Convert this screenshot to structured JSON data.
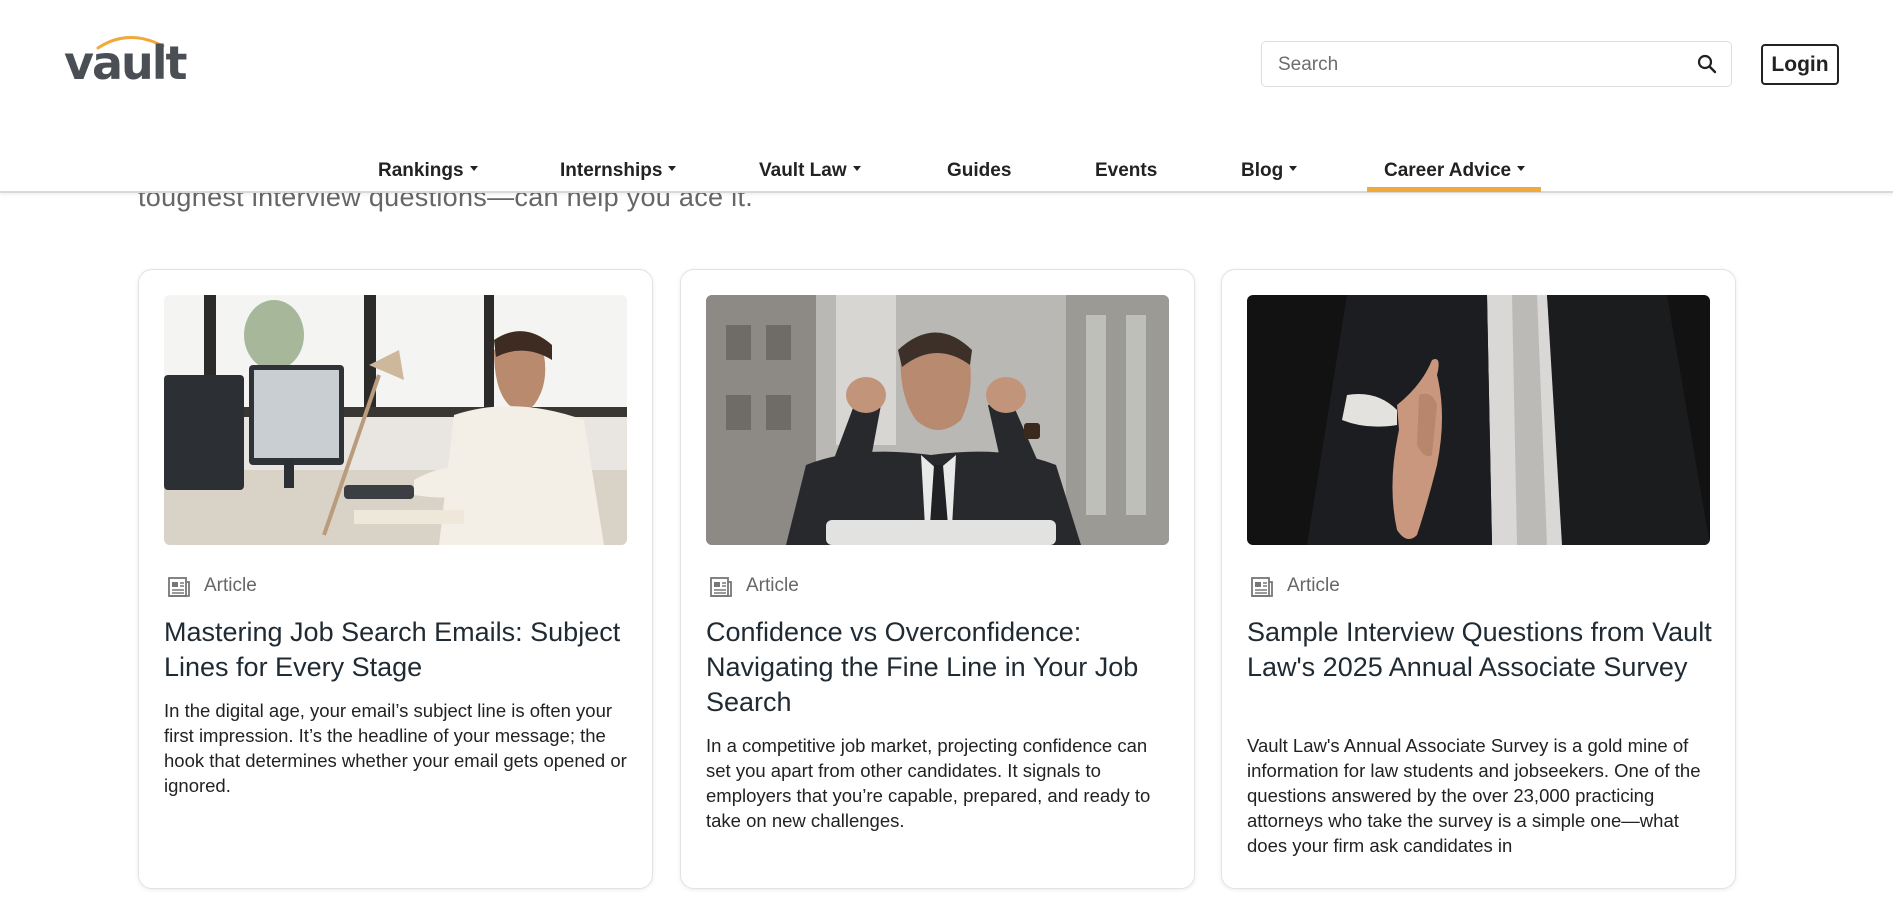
{
  "header": {
    "logo_text": "vault",
    "search": {
      "placeholder": "Search",
      "value": ""
    },
    "login_label": "Login"
  },
  "nav": {
    "items": [
      {
        "label": "Rankings",
        "dropdown": true
      },
      {
        "label": "Internships",
        "dropdown": true
      },
      {
        "label": "Vault Law",
        "dropdown": true
      },
      {
        "label": "Guides",
        "dropdown": false
      },
      {
        "label": "Events",
        "dropdown": false
      },
      {
        "label": "Blog",
        "dropdown": true
      },
      {
        "label": "Career Advice",
        "dropdown": true,
        "active": true
      }
    ],
    "active_color": "#f2a93b"
  },
  "intro_text": "toughest interview questions—can help you ace it.",
  "cards": [
    {
      "type": "Article",
      "image": "man-smiling-at-computer-desk",
      "title": "Mastering Job Search Emails: Subject Lines for Every Stage",
      "description": "In the digital age, your email’s subject line is often your first impression. It’s the headline of your message; the hook that determines whether your email gets opened or ignored."
    },
    {
      "type": "Article",
      "image": "man-celebrating-fists-raised",
      "title": "Confidence vs Overconfidence: Navigating the Fine Line in Your Job Search",
      "description": "In a competitive job market, projecting confidence can set you apart from other candidates. It signals to employers that you’re capable, prepared, and ready to take on new challenges."
    },
    {
      "type": "Article",
      "image": "businessman-extending-handshake",
      "title": "Sample Interview Questions from Vault Law's 2025 Annual Associate Survey",
      "description": "Vault Law's Annual Associate Survey is a gold mine of information for law students and jobseekers. One of the questions answered by the over 23,000 practicing attorneys who take the survey is a simple one—what does your firm ask candidates in"
    }
  ],
  "colors": {
    "accent": "#f2a93b",
    "text": "#1f2a33",
    "muted": "#666666"
  }
}
